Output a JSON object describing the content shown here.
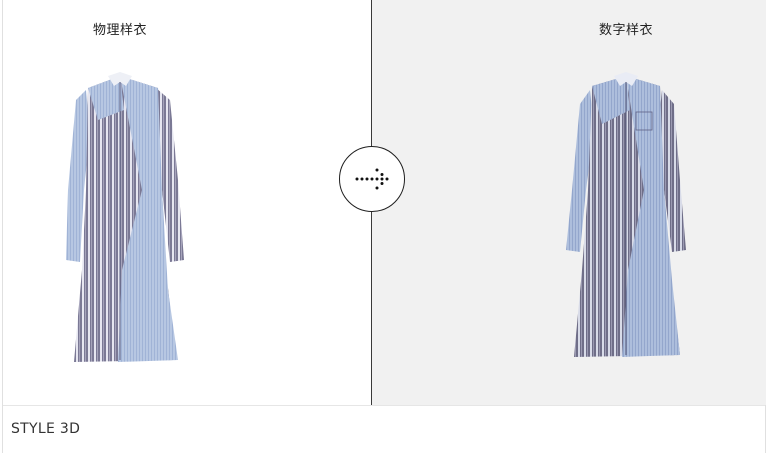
{
  "panels": {
    "left": {
      "title": "物理样衣"
    },
    "right": {
      "title": "数字样衣"
    }
  },
  "transition": {
    "icon": "dotted-arrow-right-icon"
  },
  "footer": {
    "brand": "STYLE 3D"
  },
  "colors": {
    "divider": "#3a3a3a",
    "right_background": "#f1f1f1",
    "stripe_blue": "#b9c8e3",
    "stripe_dark": "#7c7896"
  }
}
